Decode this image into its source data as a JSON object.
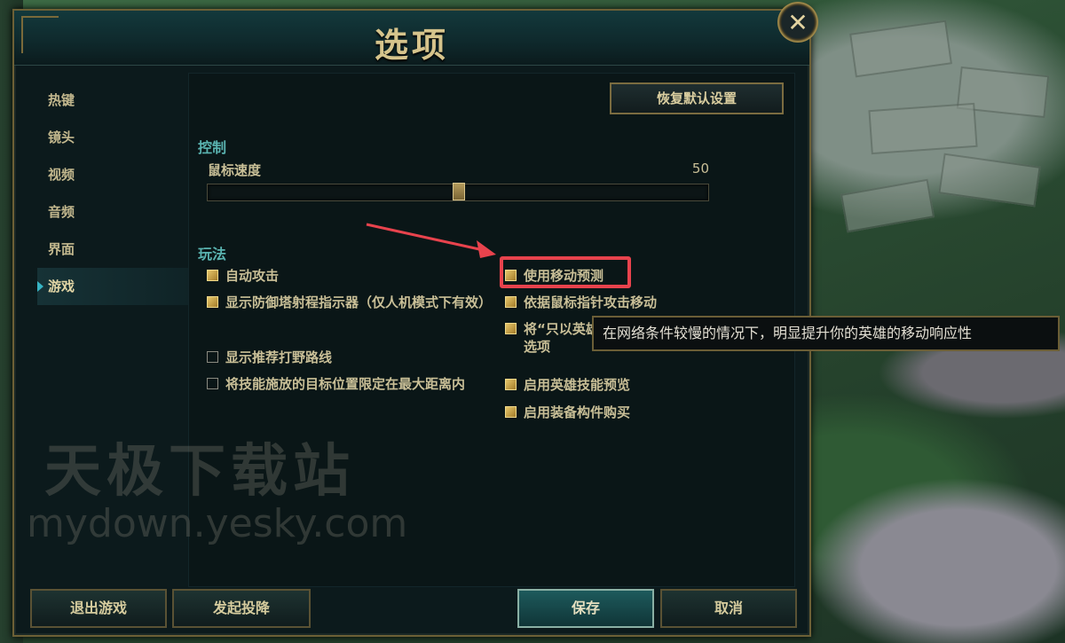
{
  "dialog": {
    "title": "选项"
  },
  "sidebar": {
    "items": [
      {
        "label": "热键"
      },
      {
        "label": "镜头"
      },
      {
        "label": "视频"
      },
      {
        "label": "音频"
      },
      {
        "label": "界面"
      },
      {
        "label": "游戏",
        "active": true
      }
    ]
  },
  "panel": {
    "restore_label": "恢复默认设置",
    "control": {
      "title": "控制",
      "mouse_speed_label": "鼠标速度",
      "mouse_speed_value": "50",
      "mouse_speed_fraction": 0.5
    },
    "gameplay": {
      "title": "玩法",
      "left_options": [
        {
          "label": "自动攻击",
          "checked": true
        },
        {
          "label": "显示防御塔射程指示器（仅人机模式下有效）",
          "checked": true
        },
        {
          "label": "显示推荐打野路线",
          "checked": false
        },
        {
          "label": "将技能施放的目标位置限定在最大距离内",
          "checked": false
        }
      ],
      "right_options": [
        {
          "label": "使用移动预测",
          "checked": true
        },
        {
          "label": "依据鼠标指针攻击移动",
          "checked": true
        },
        {
          "label": "将“只以英雄为目标”设为切换键相关选项",
          "checked": true
        },
        {
          "label": "启用英雄技能预览",
          "checked": true
        },
        {
          "label": "启用装备构件购买",
          "checked": true
        }
      ]
    }
  },
  "tooltip": {
    "text": "在网络条件较慢的情况下，明显提升你的英雄的移动响应性"
  },
  "watermark": {
    "text": "天极下载站",
    "url": "mydown.yesky.com"
  },
  "footer": {
    "exit_label": "退出游戏",
    "surrender_label": "发起投降",
    "save_label": "保存",
    "cancel_label": "取消"
  },
  "colors": {
    "accent": "#5ab3b0",
    "gold": "#d6c48c",
    "highlight": "#e8434d"
  }
}
